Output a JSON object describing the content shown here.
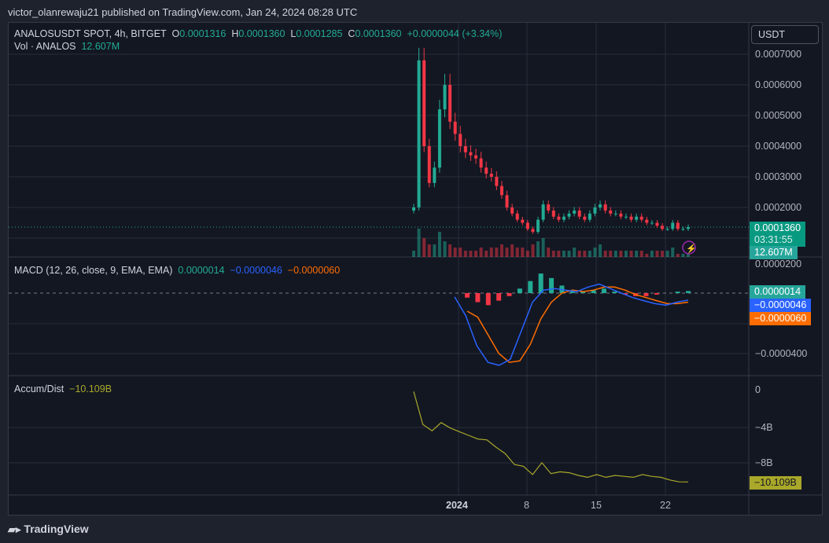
{
  "header": {
    "published": "victor_olanrewaju21 published on TradingView.com, Jan 24, 2024 08:28 UTC"
  },
  "legend": {
    "symbol": "ANALOSUSDT SPOT, 4h, BITGET",
    "o_label": "O",
    "o": "0.0001316",
    "h_label": "H",
    "h": "0.0001360",
    "l_label": "L",
    "l": "0.0001285",
    "c_label": "C",
    "c": "0.0001360",
    "change": "+0.0000044 (+3.34%)",
    "vol_label": "Vol · ANALOS",
    "vol": "12.607M"
  },
  "currency_button": "USDT",
  "price_tag": {
    "price": "0.0001360",
    "countdown": "03:31:55",
    "volume": "12.607M"
  },
  "macd_legend": {
    "label": "MACD (12, 26, close, 9, EMA, EMA)",
    "hist": "0.0000014",
    "macd": "−0.0000046",
    "signal": "−0.0000060"
  },
  "ad_legend": {
    "label": "Accum/Dist",
    "value": "−10.109B"
  },
  "footer": {
    "brand": "TradingView"
  },
  "colors": {
    "up": "#22ab94",
    "down": "#f23645",
    "macd": "#2962ff",
    "signal": "#ff6d00",
    "ad": "#a9a82a"
  },
  "chart_data": [
    {
      "type": "candlestick",
      "title": "ANALOSUSDT 4h",
      "ylim": [
        0.00011,
        0.00074
      ],
      "y_ticks": [
        "0.0007000",
        "0.0006000",
        "0.0005000",
        "0.0004000",
        "0.0003000",
        "0.0002000"
      ],
      "x_ticks": [
        "2024",
        "8",
        "15",
        "22"
      ],
      "closes": [
        0.0002,
        0.00068,
        0.0004,
        0.00028,
        0.00033,
        0.00052,
        0.0006,
        0.00048,
        0.00044,
        0.0004,
        0.00038,
        0.00037,
        0.00036,
        0.00033,
        0.00031,
        0.0003,
        0.00027,
        0.00024,
        0.0002,
        0.00018,
        0.00016,
        0.00015,
        0.00013,
        0.00012,
        0.00016,
        0.00021,
        0.00019,
        0.00017,
        0.00016,
        0.00017,
        0.00018,
        0.00019,
        0.00017,
        0.00016,
        0.00018,
        0.0002,
        0.00021,
        0.00019,
        0.00018,
        0.00018,
        0.00017,
        0.00017,
        0.00016,
        0.00017,
        0.00016,
        0.00015,
        0.00015,
        0.00014,
        0.00013,
        0.00013,
        0.00015,
        0.00013,
        0.00013,
        0.000136
      ],
      "volumes": [
        2,
        9,
        6,
        4,
        4,
        8,
        5,
        4,
        3,
        3,
        2,
        2,
        2,
        3,
        2,
        3,
        3,
        4,
        3,
        4,
        3,
        3,
        2,
        4,
        5,
        6,
        3,
        2,
        2,
        2,
        2,
        3,
        2,
        2,
        2,
        3,
        4,
        2,
        2,
        2,
        2,
        2,
        2,
        2,
        2,
        1,
        2,
        2,
        2,
        2,
        3,
        1,
        1,
        1
      ]
    },
    {
      "type": "line",
      "title": "MACD",
      "y_ticks": [
        "0.0000200",
        "−0.0000400"
      ],
      "macd": [
        -2.5e-06,
        -1.5e-05,
        -3.5e-05,
        -4.6e-05,
        -4.8e-05,
        -4.4e-05,
        -2.5e-05,
        -6e-06,
        2e-06,
        3e-06,
        2e-06,
        1e-06,
        4e-06,
        6e-06,
        3e-06,
        0.0,
        -3e-06,
        -5e-06,
        -7e-06,
        -8e-06,
        -6e-06,
        -4.6e-06
      ],
      "signal": [
        -1.2e-05,
        -1.6e-05,
        -2.8e-05,
        -4e-05,
        -4.6e-05,
        -4.5e-05,
        -3.4e-05,
        -1.7e-05,
        -6e-06,
        0.0,
        2e-06,
        1e-06,
        2e-06,
        4e-06,
        4e-06,
        2e-06,
        -1e-06,
        -3e-06,
        -5e-06,
        -7e-06,
        -7e-06,
        -6e-06
      ],
      "histogram": [
        -3e-06,
        -6e-06,
        -8e-06,
        -5e-06,
        -2e-06,
        3e-06,
        8e-06,
        1.3e-05,
        1e-05,
        5e-06,
        2e-06,
        1e-06,
        2e-06,
        3e-06,
        1e-06,
        -1e-06,
        -2e-06,
        -2e-06,
        -1e-06,
        0.0,
        1e-06,
        1.4e-06
      ]
    },
    {
      "type": "line",
      "title": "Accum/Dist",
      "y_ticks": [
        "0",
        "−4B",
        "−8B"
      ],
      "values": [
        -0.2,
        -3.8,
        -4.5,
        -3.6,
        -4.2,
        -4.6,
        -5.0,
        -5.4,
        -5.5,
        -6.3,
        -7.0,
        -8.2,
        -8.4,
        -9.3,
        -8.0,
        -9.2,
        -9.0,
        -9.1,
        -9.4,
        -9.6,
        -9.3,
        -9.6,
        -9.4,
        -9.5,
        -9.6,
        -9.3,
        -9.5,
        -9.6,
        -9.9,
        -10.1,
        -10.109
      ]
    }
  ]
}
